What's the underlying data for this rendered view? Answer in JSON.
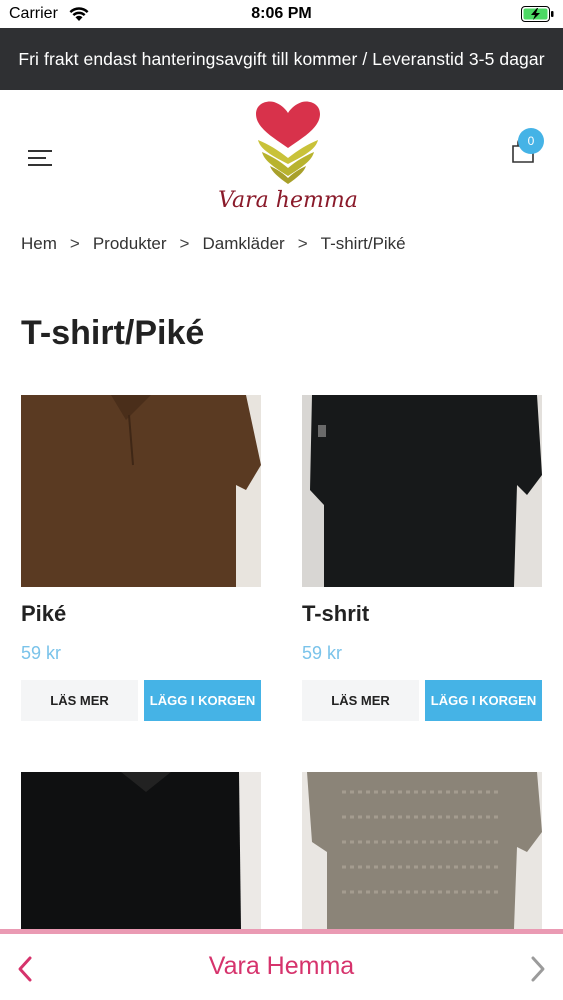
{
  "status_bar": {
    "carrier": "Carrier",
    "time": "8:06 PM"
  },
  "announcement": "Fri frakt endast hanteringsavgift till kommer / Leveranstid 3-5 dagar",
  "header": {
    "logo_text": "Vara hemma",
    "cart_count": "0"
  },
  "breadcrumb": {
    "items": [
      "Hem",
      "Produkter",
      "Damkläder",
      "T-shirt/Piké"
    ],
    "separator": ">"
  },
  "page_title": "T-shirt/Piké",
  "products": [
    {
      "name": "Piké",
      "price": "59 kr",
      "more_label": "LÄS MER",
      "cart_label": "LÄGG I KORGEN"
    },
    {
      "name": "T-shrit",
      "price": "59 kr",
      "more_label": "LÄS MER",
      "cart_label": "LÄGG I KORGEN"
    }
  ],
  "bottom_bar": {
    "title": "Vara Hemma"
  },
  "colors": {
    "announcement_bg": "#2f3033",
    "accent_blue": "#45b3e6",
    "price": "#7ac3ea",
    "brand_pink": "#d6336c",
    "bottom_border": "#ea9ab3"
  }
}
